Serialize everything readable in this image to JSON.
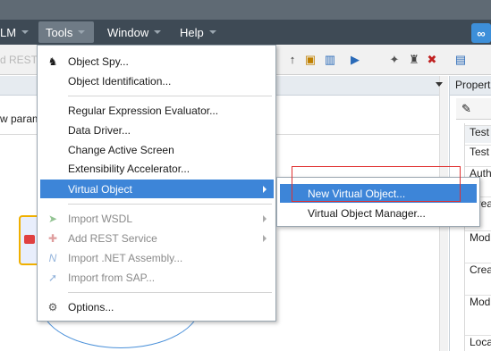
{
  "menubar": {
    "alm_label": "LM",
    "tools_label": "Tools",
    "window_label": "Window",
    "help_label": "Help"
  },
  "toolbar": {
    "left_label": "d REST"
  },
  "left_pane": {
    "new_param_label": "w param"
  },
  "properties": {
    "title": "Propert",
    "rows": [
      "Test",
      "Auth",
      "Crea",
      "Mod",
      "Crea",
      "Mod",
      "Loca"
    ]
  },
  "tools_menu": {
    "items": [
      {
        "label": "Object Spy...",
        "icon": "spy-icon"
      },
      {
        "label": "Object Identification...",
        "icon": ""
      },
      {
        "label": "Regular Expression Evaluator...",
        "icon": ""
      },
      {
        "label": "Data Driver...",
        "icon": ""
      },
      {
        "label": "Change Active Screen",
        "icon": ""
      },
      {
        "label": "Extensibility Accelerator...",
        "icon": ""
      },
      {
        "label": "Virtual Object",
        "icon": ""
      },
      {
        "label": "Import WSDL",
        "icon": "import-wsdl-icon"
      },
      {
        "label": "Add REST Service",
        "icon": "add-rest-icon"
      },
      {
        "label": "Import .NET Assembly...",
        "icon": "net-assembly-icon"
      },
      {
        "label": "Import from SAP...",
        "icon": "sap-icon"
      },
      {
        "label": "Options...",
        "icon": "options-icon"
      }
    ]
  },
  "virtual_object_submenu": {
    "items": [
      {
        "label": "New Virtual Object..."
      },
      {
        "label": "Virtual Object Manager..."
      }
    ]
  },
  "colors": {
    "menubar_bg": "#3e4a55",
    "highlight": "#3d85d8",
    "annotation_red": "#e03030"
  }
}
